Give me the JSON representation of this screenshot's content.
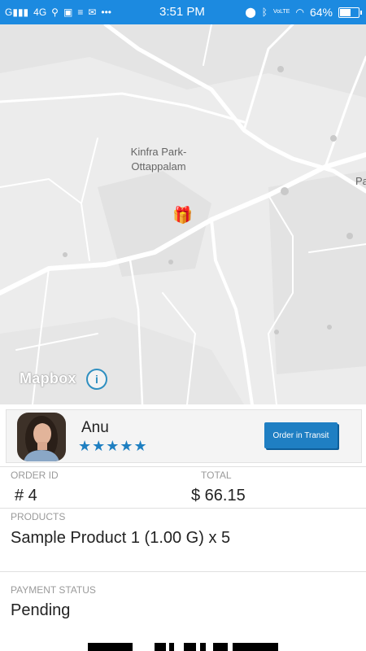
{
  "status_bar": {
    "network": "4G",
    "time": "3:51 PM",
    "volte": "VoLTE",
    "battery": "64%",
    "battery_level": 0.64,
    "icons": [
      "signal-icon",
      "usb-icon",
      "sim-icon",
      "database-icon",
      "mail-icon",
      "more-icon",
      "location-icon",
      "bluetooth-icon",
      "wifi-icon",
      "battery-icon"
    ]
  },
  "map": {
    "place_label_line1": "Kinfra Park-",
    "place_label_line2": "Ottappalam",
    "edge_label": "Pa",
    "attribution": "Mapbox",
    "info_icon": "i",
    "marker_icon": "gift-icon"
  },
  "driver": {
    "name": "Anu",
    "rating": 5,
    "stars": "★★★★★",
    "status_button": "Order in Transit"
  },
  "order": {
    "id_label": "ORDER ID",
    "id_value": "# 4",
    "total_label": "TOTAL",
    "total_value": "$ 66.15",
    "products_label": "PRODUCTS",
    "products_value": "Sample Product  1 (1.00 G) x 5",
    "payment_label": "PAYMENT STATUS",
    "payment_value": "Pending"
  },
  "colors": {
    "status_bar": "#1c8ae0",
    "accent": "#1f7fc3",
    "label_gray": "#9a9a9a"
  }
}
